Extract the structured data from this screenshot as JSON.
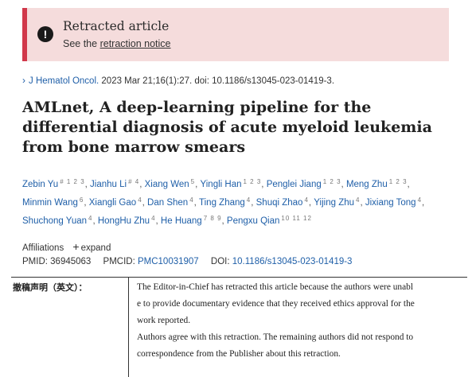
{
  "banner": {
    "title": "Retracted article",
    "sub_prefix": "See the ",
    "link": "retraction notice"
  },
  "citation": {
    "journal": "J Hematol Oncol.",
    "details": " 2023 Mar 21;16(1):27. doi: 10.1186/s13045-023-01419-3."
  },
  "title": "AMLnet, A deep-learning pipeline for the differential diagnosis of acute myeloid leukemia from bone marrow smears",
  "authors": [
    {
      "name": "Zebin Yu",
      "sup": "# 1 2 3"
    },
    {
      "name": "Jianhu Li",
      "sup": "# 4"
    },
    {
      "name": "Xiang Wen",
      "sup": "5"
    },
    {
      "name": "Yingli Han",
      "sup": "1 2 3"
    },
    {
      "name": "Penglei Jiang",
      "sup": "1 2 3"
    },
    {
      "name": "Meng Zhu",
      "sup": "1 2 3"
    },
    {
      "name": "Minmin Wang",
      "sup": "6"
    },
    {
      "name": "Xiangli Gao",
      "sup": "4"
    },
    {
      "name": "Dan Shen",
      "sup": "4"
    },
    {
      "name": "Ting Zhang",
      "sup": "4"
    },
    {
      "name": "Shuqi Zhao",
      "sup": "4"
    },
    {
      "name": "Yijing Zhu",
      "sup": "4"
    },
    {
      "name": "Jixiang Tong",
      "sup": "4"
    },
    {
      "name": "Shuchong Yuan",
      "sup": "4"
    },
    {
      "name": "HongHu Zhu",
      "sup": "4"
    },
    {
      "name": "He Huang",
      "sup": "7 8 9"
    },
    {
      "name": "Pengxu Qian",
      "sup": "10 11 12"
    }
  ],
  "affiliations": {
    "label": "Affiliations",
    "expand": "expand"
  },
  "ids": {
    "pmid_label": "PMID:",
    "pmid": "36945063",
    "pmcid_label": "PMCID:",
    "pmcid": "PMC10031907",
    "doi_label": "DOI:",
    "doi": "10.1186/s13045-023-01419-3"
  },
  "statement": {
    "label": "撤稿声明（英文）：",
    "lines": [
      "The Editor-in-Chief has retracted this article because the authors were unabl",
      "e to provide documentary evidence that they received ethics approval for the",
      "work reported.",
      "Authors agree with this retraction. The remaining authors did not respond to",
      "correspondence from the Publisher about this retraction."
    ]
  },
  "colors": {
    "banner_bg": "#f5dcdc",
    "banner_accent": "#d1384b",
    "link": "#1f5fa8"
  }
}
